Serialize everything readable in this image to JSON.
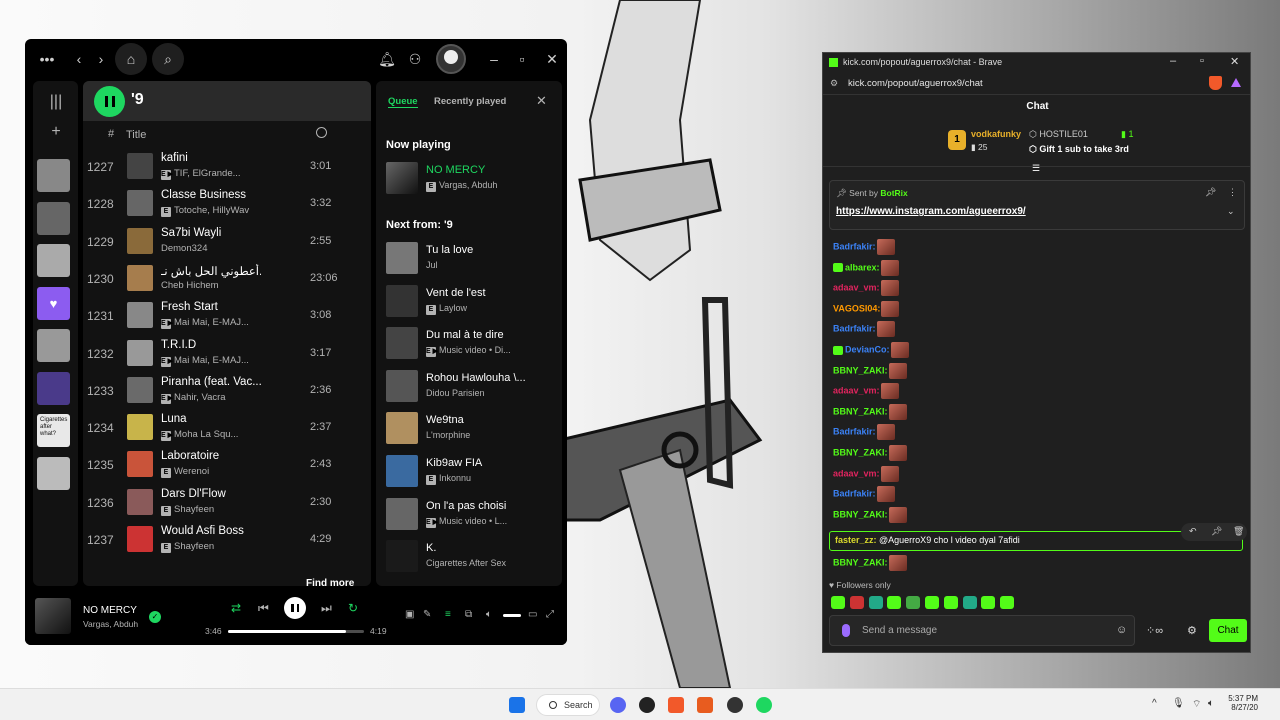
{
  "spotify": {
    "playlist_title": "'9",
    "col_hash": "#",
    "col_title": "Title",
    "tracks": [
      {
        "num": "1227",
        "name": "kafini",
        "meta": "TIF, ElGrande...",
        "dur": "3:01",
        "badges": "E ▶",
        "color": "#444"
      },
      {
        "num": "1228",
        "name": "Classe Business",
        "meta": "Totoche, HillyWav",
        "dur": "3:32",
        "badges": "E",
        "color": "#666"
      },
      {
        "num": "1229",
        "name": "Sa7bi Wayli",
        "meta": "Demon324",
        "dur": "2:55",
        "badges": "",
        "color": "#8a6a3a"
      },
      {
        "num": "1230",
        "name": "أعطوني الحل باش نـ...",
        "meta": "Cheb Hichem",
        "dur": "23:06",
        "badges": "",
        "color": "#a67d4d"
      },
      {
        "num": "1231",
        "name": "Fresh Start",
        "meta": "Mai Mai, E-MAJ...",
        "dur": "3:08",
        "badges": "E ▶",
        "color": "#888"
      },
      {
        "num": "1232",
        "name": "T.R.I.D",
        "meta": "Mai Mai, E-MAJ...",
        "dur": "3:17",
        "badges": "E ▶",
        "color": "#999"
      },
      {
        "num": "1233",
        "name": "Piranha (feat. Vac...",
        "meta": "Nahir, Vacra",
        "dur": "2:36",
        "badges": "E ▶",
        "color": "#6a6a6a"
      },
      {
        "num": "1234",
        "name": "Luna",
        "meta": "Moha La Squ...",
        "dur": "2:37",
        "badges": "E ▶",
        "color": "#c8b44a"
      },
      {
        "num": "1235",
        "name": "Laboratoire",
        "meta": "Werenoi",
        "dur": "2:43",
        "badges": "E",
        "color": "#c9543a"
      },
      {
        "num": "1236",
        "name": "Dars Dl'Flow",
        "meta": "Shayfeen",
        "dur": "2:30",
        "badges": "E",
        "color": "#8a5a5a"
      },
      {
        "num": "1237",
        "name": "Would Asfi Boss",
        "meta": "Shayfeen",
        "dur": "4:29",
        "badges": "E",
        "color": "#c33"
      }
    ],
    "find_more": "Find more",
    "queue_tab": "Queue",
    "recent_tab": "Recently played",
    "now_playing_label": "Now playing",
    "now_playing": {
      "name": "NO MERCY",
      "meta": "Vargas, Abduh",
      "badges": "E"
    },
    "next_from_label": "Next from: '9",
    "queue": [
      {
        "name": "Tu la love",
        "meta": "Jul",
        "badges": "",
        "color": "#777"
      },
      {
        "name": "Vent de l'est",
        "meta": "Laylow",
        "badges": "E",
        "color": "#333"
      },
      {
        "name": "Du mal à te dire",
        "meta": "Music video • Di...",
        "badges": "E ▶",
        "color": "#444"
      },
      {
        "name": "Rohou Hawlouha \\...",
        "meta": "Didou Parisien",
        "badges": "",
        "color": "#555"
      },
      {
        "name": "We9tna",
        "meta": "L'morphine",
        "badges": "",
        "color": "#b09060"
      },
      {
        "name": "Kib9aw FIA",
        "meta": "Inkonnu",
        "badges": "E",
        "color": "#3a6aa0"
      },
      {
        "name": "On l'a pas choisi",
        "meta": "Music video • L...",
        "badges": "E ▶",
        "color": "#666"
      },
      {
        "name": "K.",
        "meta": "Cigarettes After Sex",
        "badges": "",
        "color": "#1a1a1a"
      }
    ],
    "player": {
      "title": "NO MERCY",
      "artist": "Vargas, Abduh",
      "current_time": "3:46",
      "total_time": "4:19",
      "progress": 0.87
    },
    "library_thumbs": [
      "#888",
      "#666",
      "#aaa",
      "#8c5cf0",
      "#999",
      "#4a3a8a",
      "#e8e8e8",
      "#bbb"
    ],
    "library_thumb_text": "Cigarettes after what?"
  },
  "browser": {
    "window_title": "kick.com/popout/aguerrox9/chat - Brave",
    "url": "kick.com/popout/aguerrox9/chat",
    "chat_header": "Chat",
    "gift": {
      "top_user": "vodkafunky",
      "top_rank": "1",
      "top_count": "25",
      "second_user": "HOSTILE01",
      "second_count": "1",
      "cta": "Gift 1 sub to take 3rd"
    },
    "pinned": {
      "sent_by": "Sent by",
      "bot": "BotRix",
      "link": "https://www.instagram.com/agueerrox9/"
    },
    "messages": [
      {
        "user": "Badrfakir:",
        "color": "#3b82f6",
        "badge": false
      },
      {
        "user": "albarex:",
        "color": "#53fc18",
        "badge": true
      },
      {
        "user": "adaav_vm:",
        "color": "#e0245e",
        "badge": false
      },
      {
        "user": "VAGOSI04:",
        "color": "#ff9900",
        "badge": false
      },
      {
        "user": "Badrfakir:",
        "color": "#3b82f6",
        "badge": false
      },
      {
        "user": "DevianCo:",
        "color": "#3b82f6",
        "badge": true
      },
      {
        "user": "BBNY_ZAKI:",
        "color": "#53fc18",
        "badge": false
      },
      {
        "user": "adaav_vm:",
        "color": "#e0245e",
        "badge": false
      },
      {
        "user": "BBNY_ZAKI:",
        "color": "#53fc18",
        "badge": false
      },
      {
        "user": "Badrfakir:",
        "color": "#3b82f6",
        "badge": false
      },
      {
        "user": "BBNY_ZAKI:",
        "color": "#53fc18",
        "badge": false
      },
      {
        "user": "adaav_vm:",
        "color": "#e0245e",
        "badge": false
      },
      {
        "user": "Badrfakir:",
        "color": "#3b82f6",
        "badge": false
      },
      {
        "user": "BBNY_ZAKI:",
        "color": "#53fc18",
        "badge": false
      }
    ],
    "highlight": {
      "user": "faster_zz:",
      "text": "@AguerroX9 cho l video dyal 7afidi"
    },
    "last_msg": {
      "user": "BBNY_ZAKI:",
      "color": "#53fc18"
    },
    "followers_only": "Followers only",
    "input_placeholder": "Send a message",
    "chat_button": "Chat"
  },
  "taskbar": {
    "search": "Search",
    "time": "5:37 PM",
    "date": "8/27/20"
  },
  "colors": {
    "spotify_green": "#1ed760",
    "kick_green": "#53fc18"
  }
}
